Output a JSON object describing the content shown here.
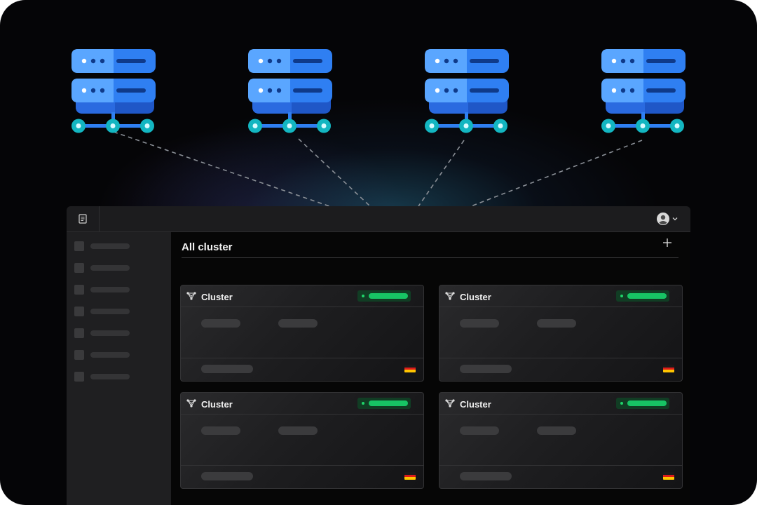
{
  "main": {
    "title": "All cluster"
  },
  "clusters": [
    {
      "title": "Cluster",
      "status": "running"
    },
    {
      "title": "Cluster",
      "status": "running"
    },
    {
      "title": "Cluster",
      "status": "running"
    },
    {
      "title": "Cluster",
      "status": "running"
    }
  ],
  "sidebar": {
    "item_count": 7
  },
  "icons": {
    "logo": "document-icon",
    "user": "user-avatar-icon",
    "menu": "chevron-down-icon",
    "add": "plus-icon",
    "cluster": "cluster-network-icon",
    "server": "server-rack-icon",
    "flag": "germany-flag-icon"
  },
  "colors": {
    "server_light": "#5aa6ff",
    "server_mid": "#2f7ff2",
    "server_dark": "#1f57c7",
    "node_teal": "#13b6c1",
    "status_green": "#17c464",
    "background": "#050507"
  }
}
